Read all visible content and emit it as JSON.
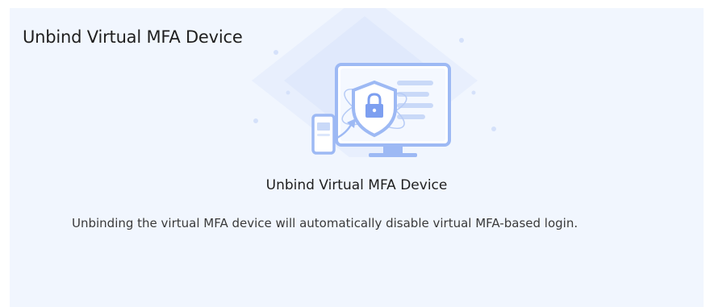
{
  "card": {
    "title": "Unbind Virtual MFA Device",
    "illustration_icon": "monitor-phone-shield-lock",
    "headline": "Unbind Virtual MFA Device",
    "description": "Unbinding the virtual MFA device will automatically disable virtual MFA-based login."
  },
  "colors": {
    "card_background": "#f1f6fe",
    "illustration_primary": "#9db9f4",
    "illustration_light": "#dce7fb",
    "text_primary": "#1f1f1f"
  }
}
